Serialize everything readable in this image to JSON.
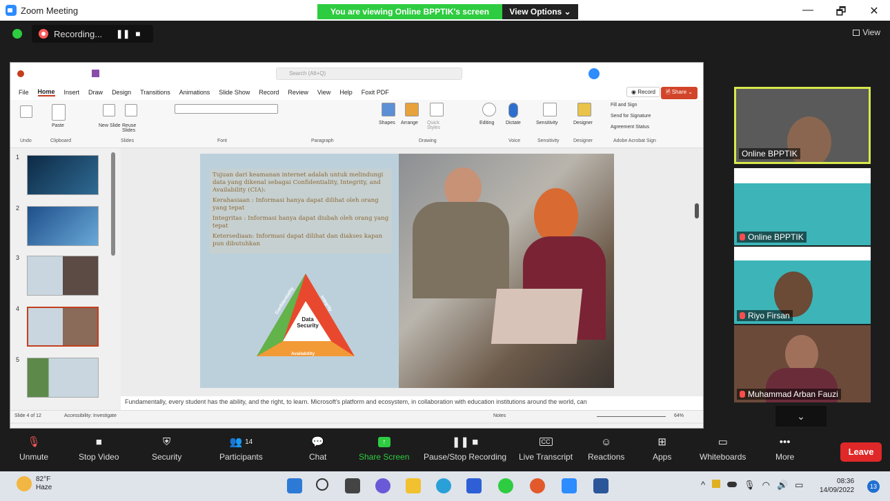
{
  "window": {
    "title": "Zoom Meeting",
    "banner": "You are viewing Online BPPTIK's screen",
    "view_options": "View Options ⌄",
    "min": "—",
    "max": "🗗",
    "close": "✕"
  },
  "recording": {
    "label": "Recording...",
    "pause": "❚❚",
    "stop": "■",
    "view": "View"
  },
  "ppt": {
    "search": "Search (Alt+Q)",
    "tabs": [
      "File",
      "Home",
      "Insert",
      "Draw",
      "Design",
      "Transitions",
      "Animations",
      "Slide Show",
      "Record",
      "Review",
      "View",
      "Help",
      "Foxit PDF"
    ],
    "record_btn": "◉ Record",
    "share_btn": "🖻 Share ⌄",
    "ribbon_groups": [
      "Undo",
      "Clipboard",
      "Slides",
      "Font",
      "Paragraph",
      "Drawing",
      "Voice",
      "Sensitivity",
      "Designer",
      "Adobe Acrobat Sign"
    ],
    "ribbon_labels": {
      "paste": "Paste",
      "new_slide": "New Slide",
      "reuse_slides": "Reuse Slides",
      "shapes": "Shapes",
      "arrange": "Arrange",
      "quick_styles": "Quick Styles",
      "editing": "Editing",
      "dictate": "Dictate",
      "sensitivity": "Sensitivity",
      "designer": "Designer",
      "fill_sign": "Fill and Sign",
      "send_sig": "Send for Signature",
      "agreement": "Agreement Status"
    },
    "slide": {
      "para1": "Tujuan dari keamanan internet adalah untuk melindungi data yang dikenal sebagai Confidentiality, Integrity, and Availability (CIA):",
      "para2": "Kerahasiaan : Informasi hanya dapat dilihat oleh orang yang tepat",
      "para3": "Integritas : Informasi hanya dapat diubah oleh orang yang tepat",
      "para4": "Ketersediaan: Informasi dapat dilihat dan diakses kapan pun dibutuhkan",
      "tri_left": "Confidentiality",
      "tri_right": "Integrity",
      "tri_bottom": "Availability",
      "tri_center": "Data Security"
    },
    "thumb_numbers": [
      "1",
      "2",
      "3",
      "4",
      "5"
    ],
    "notes": "Fundamentally, every student has the ability, and the right, to learn. Microsoft's platform and ecosystem, in collaboration with education institutions around the world, can",
    "status_slide": "Slide 4 of 12",
    "status_access": "Accessibility: Investigate",
    "status_notes": "Notes",
    "zoom_pct": "64%"
  },
  "participants": [
    {
      "name": "Online BPPTIK"
    },
    {
      "name": "Online BPPTIK"
    },
    {
      "name": "Riyo Firsan"
    },
    {
      "name": "Muhammad Arban Fauzi"
    }
  ],
  "toolbar": {
    "unmute": "Unmute",
    "stop_video": "Stop Video",
    "security": "Security",
    "participants": "Participants",
    "participants_count": "14",
    "chat": "Chat",
    "share_screen": "Share Screen",
    "pause_recording": "Pause/Stop Recording",
    "live_transcript": "Live Transcript",
    "reactions": "Reactions",
    "apps": "Apps",
    "whiteboards": "Whiteboards",
    "more": "More",
    "leave": "Leave"
  },
  "taskbar": {
    "temp": "82°F",
    "weather": "Haze",
    "time": "08:36",
    "date": "14/09/2022",
    "notif_count": "13"
  },
  "colors": {
    "accent_green": "#2ecc40",
    "leave_red": "#e02828",
    "ppt_red": "#c43e1c",
    "tile_teal": "#3cb4b8",
    "active_speaker": "#d7e94b"
  }
}
